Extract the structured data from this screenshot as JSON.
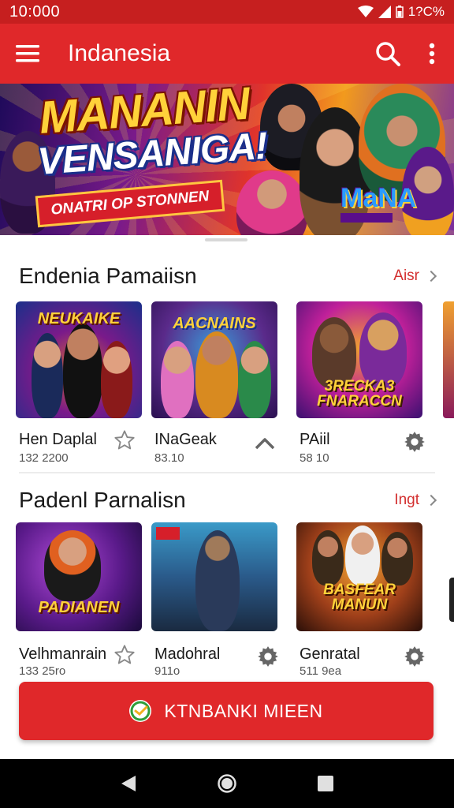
{
  "status_bar": {
    "time": "10:000",
    "battery_text": "1?C%"
  },
  "app_bar": {
    "title": "Indanesia"
  },
  "banner": {
    "title_line1": "MANANIN",
    "title_line2": "VENSANIGA!",
    "ribbon_text": "ONATRI OP STONNEN",
    "logo_text": "MaNA"
  },
  "sections": [
    {
      "title": "Endenia Pamaiisn",
      "more_label": "Aisr",
      "games": [
        {
          "name": "Hen Daplal",
          "meta": "132 2200",
          "thumb_text": "NEUKAIKE",
          "action_icon": "star-outline-icon"
        },
        {
          "name": "INaGeak",
          "meta": "83.10",
          "thumb_text": "AACNAINS",
          "action_icon": "chevron-up-icon"
        },
        {
          "name": "PAiil",
          "meta": "58 10",
          "thumb_text": "3RECKA3 FNARACCN",
          "action_icon": "settings-icon"
        }
      ]
    },
    {
      "title": "Padenl Parnalisn",
      "more_label": "Ingt",
      "games": [
        {
          "name": "Velhmanrain",
          "meta": "133 25ro",
          "thumb_text": "PADIANEN",
          "action_icon": "star-outline-icon"
        },
        {
          "name": "Madohral",
          "meta": "911o",
          "thumb_text": "",
          "action_icon": "settings-icon"
        },
        {
          "name": "Genratal",
          "meta": "511 9ea",
          "thumb_text": "BASFEAR MANUN",
          "action_icon": "settings-icon"
        }
      ]
    }
  ],
  "cta": {
    "label": "KTNBANKI MIEEN"
  },
  "colors": {
    "primary": "#e0282a",
    "status_bar": "#c61f1f",
    "link": "#d32f2f"
  }
}
